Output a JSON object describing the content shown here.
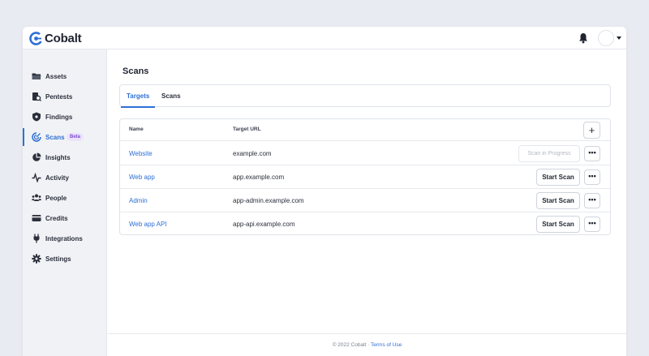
{
  "app": {
    "brand": "Cobalt",
    "accent": "#2f6fd6",
    "beta_color": "#7c4dcc"
  },
  "header": {
    "bell_icon": "bell-icon",
    "avatar_icon": "avatar",
    "caret_icon": "chevron-down-icon"
  },
  "sidebar": {
    "items": [
      {
        "label": "Assets",
        "icon": "folder-icon"
      },
      {
        "label": "Pentests",
        "icon": "pentest-icon"
      },
      {
        "label": "Findings",
        "icon": "shield-icon"
      },
      {
        "label": "Scans",
        "icon": "scan-icon",
        "badge": "Beta",
        "active": true
      },
      {
        "label": "Insights",
        "icon": "pie-chart-icon"
      },
      {
        "label": "Activity",
        "icon": "activity-icon"
      },
      {
        "label": "People",
        "icon": "people-icon"
      },
      {
        "label": "Credits",
        "icon": "credit-card-icon"
      },
      {
        "label": "Integrations",
        "icon": "plug-icon"
      },
      {
        "label": "Settings",
        "icon": "gear-icon"
      }
    ]
  },
  "main": {
    "title": "Scans",
    "tabs": [
      {
        "label": "Targets",
        "active": true
      },
      {
        "label": "Scans",
        "active": false
      }
    ],
    "table": {
      "columns": {
        "name": "Name",
        "url": "Target URL"
      },
      "add_icon": "plus-icon",
      "rows": [
        {
          "name": "Website",
          "url": "example.com",
          "action": "Scan in Progress",
          "disabled": true
        },
        {
          "name": "Web app",
          "url": "app.example.com",
          "action": "Start Scan",
          "disabled": false
        },
        {
          "name": "Admin",
          "url": "app-admin.example.com",
          "action": "Start Scan",
          "disabled": false
        },
        {
          "name": "Web app API",
          "url": "app-api.example.com",
          "action": "Start Scan",
          "disabled": false
        }
      ],
      "more_label": "•••"
    }
  },
  "footer": {
    "copyright": "© 2022 Cobalt · ",
    "terms": "Terms of Use"
  }
}
